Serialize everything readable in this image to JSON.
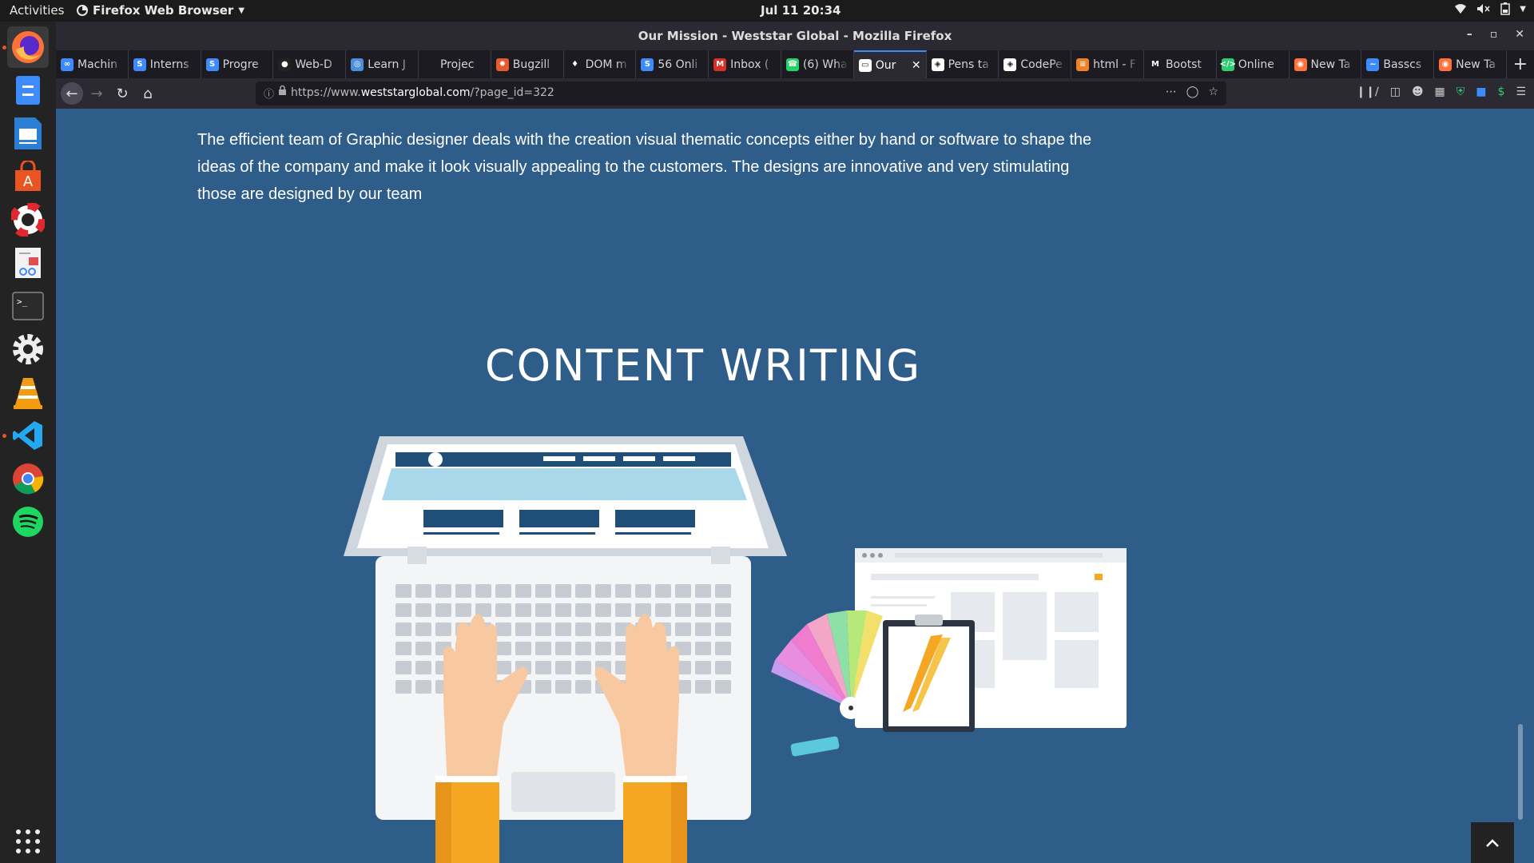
{
  "topbar": {
    "activities": "Activities",
    "app_name": "Firefox Web Browser",
    "clock": "Jul 11  20:34"
  },
  "dock": {
    "apps": [
      "firefox-icon",
      "files-icon",
      "writer-icon",
      "software-icon",
      "help-icon",
      "document-viewer-icon",
      "terminal-icon",
      "settings-icon",
      "vlc-icon",
      "vscode-icon",
      "chrome-icon",
      "spotify-icon",
      "show-apps-icon"
    ]
  },
  "window": {
    "title": "Our Mission - Weststar Global - Mozilla Firefox"
  },
  "tabs": [
    {
      "label": "Machin",
      "icon": "infinity-icon",
      "color": "#3d8bfd"
    },
    {
      "label": "Interns",
      "icon": "s-logo-icon",
      "color": "#3d8bfd"
    },
    {
      "label": "Progre",
      "icon": "s-logo-icon",
      "color": "#3d8bfd"
    },
    {
      "label": "Web-D",
      "icon": "github-icon",
      "color": "#222222"
    },
    {
      "label": "Learn J",
      "icon": "globe-icon",
      "color": "#4a8fe0"
    },
    {
      "label": "Projec",
      "icon": "blank-icon",
      "color": "#1c1b22"
    },
    {
      "label": "Bugzill",
      "icon": "bug-icon",
      "color": "#e65a2c"
    },
    {
      "label": "DOM m",
      "icon": "mdn-icon",
      "color": "#1c1b22"
    },
    {
      "label": "56 Onli",
      "icon": "s-logo-icon",
      "color": "#3d8bfd"
    },
    {
      "label": "Inbox (",
      "icon": "gmail-icon",
      "color": "#d93025"
    },
    {
      "label": "(6) Wha",
      "icon": "whatsapp-icon",
      "color": "#25d366"
    },
    {
      "label": "Our",
      "icon": "page-icon",
      "color": "#ffffff",
      "active": true
    },
    {
      "label": "Pens ta",
      "icon": "codepen-icon",
      "color": "#ffffff"
    },
    {
      "label": "CodePe",
      "icon": "codepen-icon",
      "color": "#ffffff"
    },
    {
      "label": "html - F",
      "icon": "stackoverflow-icon",
      "color": "#f48024"
    },
    {
      "label": "Bootst",
      "icon": "medium-icon",
      "color": "#1c1b22"
    },
    {
      "label": "Online",
      "icon": "code-icon",
      "color": "#2ecc71"
    },
    {
      "label": "New Ta",
      "icon": "firefox-icon",
      "color": "#ff7139"
    },
    {
      "label": "Basscs",
      "icon": "wave-icon",
      "color": "#3d8bfd"
    },
    {
      "label": "New Ta",
      "icon": "firefox-icon",
      "color": "#ff7139"
    }
  ],
  "urlbar": {
    "prefix": "https://www.",
    "domain": "weststarglobal.com",
    "path": "/?page_id=322"
  },
  "page": {
    "paragraph": "The efficient team of Graphic designer deals with the creation visual thematic concepts either by hand or software to shape the ideas of the company and make it look visually appealing to the customers. The designs are innovative and very stimulating those are designed by our team",
    "illustration_title": "CONTENT WRITING"
  },
  "colors": {
    "page_bg": "#2f5d8a",
    "accent": "#3d8bfd",
    "sleeve": "#f5a623"
  }
}
